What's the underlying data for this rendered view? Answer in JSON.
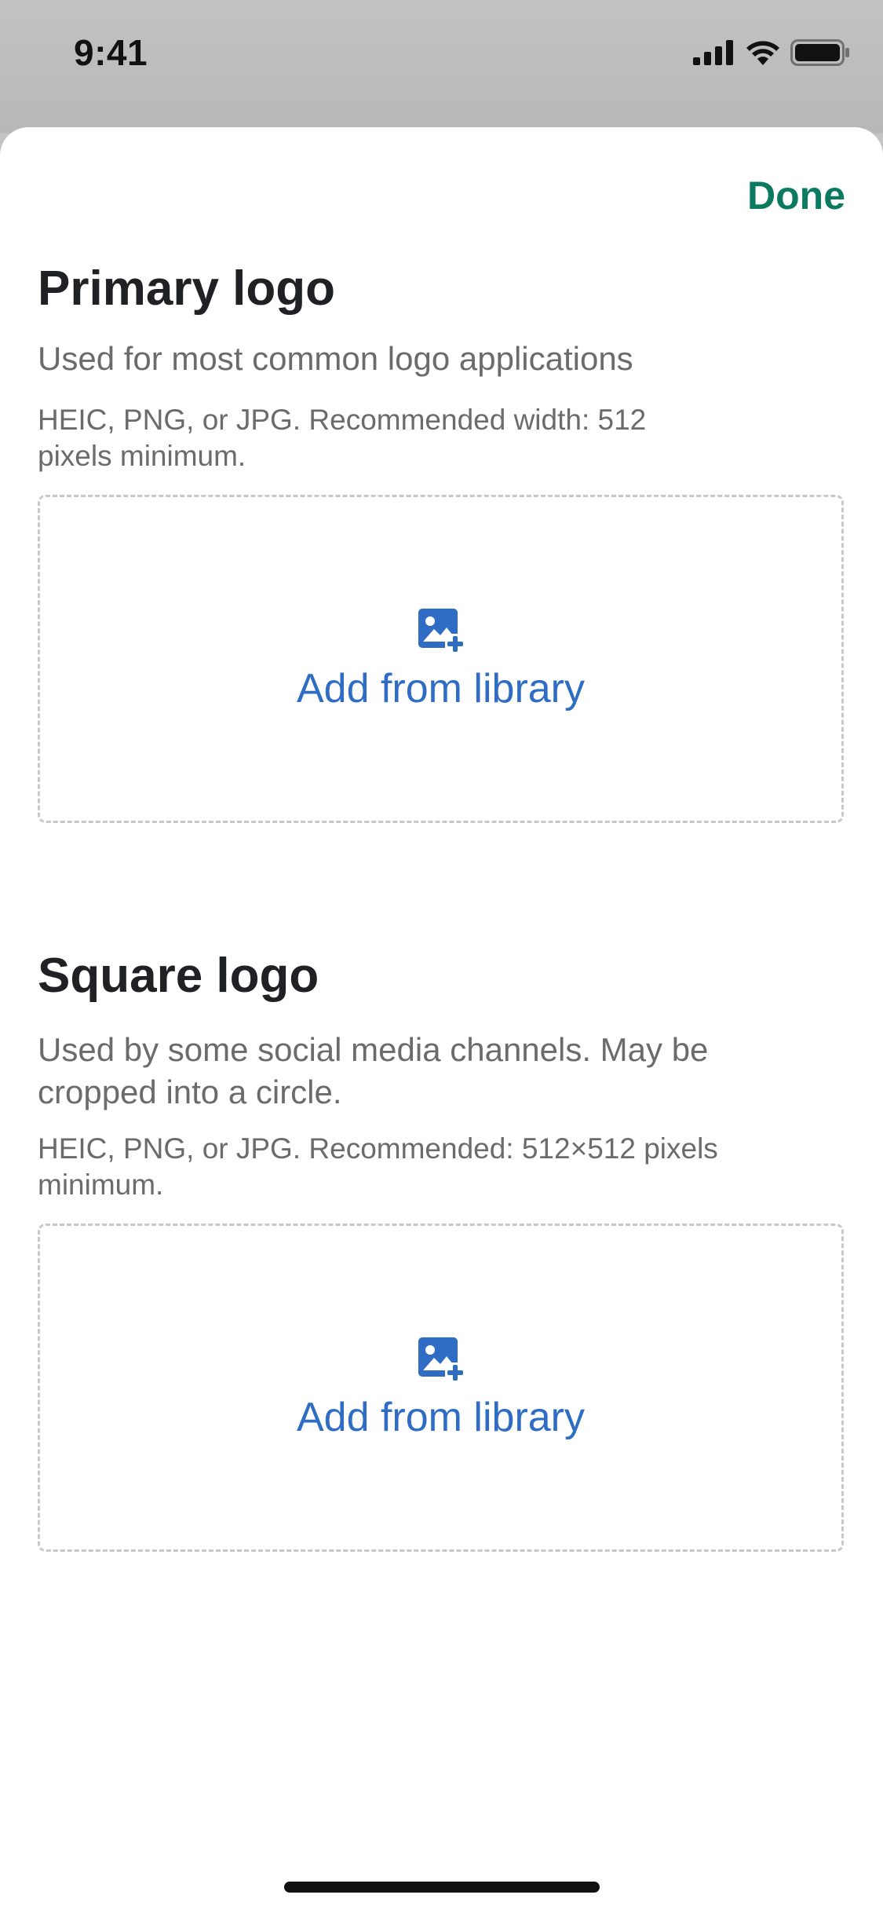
{
  "status_bar": {
    "time": "9:41",
    "icons": [
      "cellular-signal-icon",
      "wifi-icon",
      "battery-icon"
    ]
  },
  "header": {
    "done_label": "Done"
  },
  "sections": [
    {
      "title": "Primary logo",
      "description": "Used for most common logo applications",
      "requirements": "HEIC, PNG, or JPG. Recommended width: 512 pixels minimum.",
      "action_label": "Add from library",
      "action_icon": "add-photo-icon"
    },
    {
      "title": "Square logo",
      "description": "Used by some social media channels. May be cropped into a circle.",
      "requirements": "HEIC, PNG, or JPG. Recommended: 512×512 pixels minimum.",
      "action_label": "Add from library",
      "action_icon": "add-photo-icon"
    }
  ],
  "colors": {
    "accent_green": "#0b7a5f",
    "link_blue": "#2f6dc4",
    "title_text": "#202124",
    "secondary_text": "#6b6b6b",
    "dashed_border": "#c8c8c8"
  }
}
